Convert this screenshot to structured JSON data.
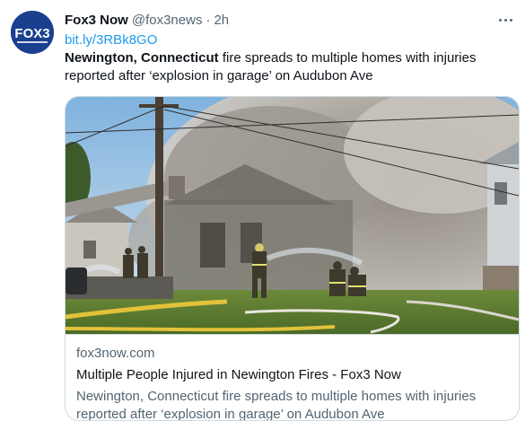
{
  "tweet": {
    "author_name": "Fox3 Now",
    "author_handle": "@fox3news",
    "separator": "·",
    "time": "2h",
    "link": "bit.ly/3RBk8GO",
    "text_bold": "Newington, Connecticut",
    "text_rest": " fire spreads to multiple homes with injuries reported after ‘explosion in garage’ on Audubon Ave"
  },
  "avatar": {
    "logo_text": "FOX3",
    "brand_color": "#1b3f8f"
  },
  "card": {
    "domain": "fox3now.com",
    "title": "Multiple People Injured in Newington Fires - Fox3 Now",
    "description": "Newington, Connecticut fire spreads to multiple homes with injuries reported after ‘explosion in garage’ on Audubon Ave"
  },
  "colors": {
    "link": "#1d9bf0",
    "secondary_text": "#536471",
    "border": "#cfd9de"
  }
}
